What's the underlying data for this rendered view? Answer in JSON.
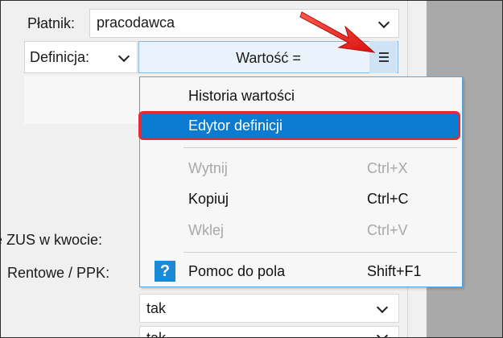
{
  "platnik": {
    "label": "Płatnik:",
    "value": "pracodawca"
  },
  "definicja": {
    "label": "Definicja:"
  },
  "value_field": {
    "text": "Wartość ="
  },
  "labels": {
    "zus": "e ZUS w kwocie:",
    "rentowe": "Rentowe / PPK:"
  },
  "lower_combo": {
    "value": "tak",
    "value2": "tak"
  },
  "context_menu": {
    "items": [
      {
        "label": "Historia wartości",
        "shortcut": ""
      },
      {
        "label": "Edytor definicji",
        "shortcut": ""
      },
      {
        "label": "Wytnij",
        "shortcut": "Ctrl+X"
      },
      {
        "label": "Kopiuj",
        "shortcut": "Ctrl+C"
      },
      {
        "label": "Wklej",
        "shortcut": "Ctrl+V"
      },
      {
        "label": "Pomoc do pola",
        "shortcut": "Shift+F1"
      }
    ],
    "help_icon_glyph": "?"
  },
  "colors": {
    "selection": "#0a7bd1",
    "highlight_border": "#e12b35",
    "arrow": "#e8211f"
  }
}
